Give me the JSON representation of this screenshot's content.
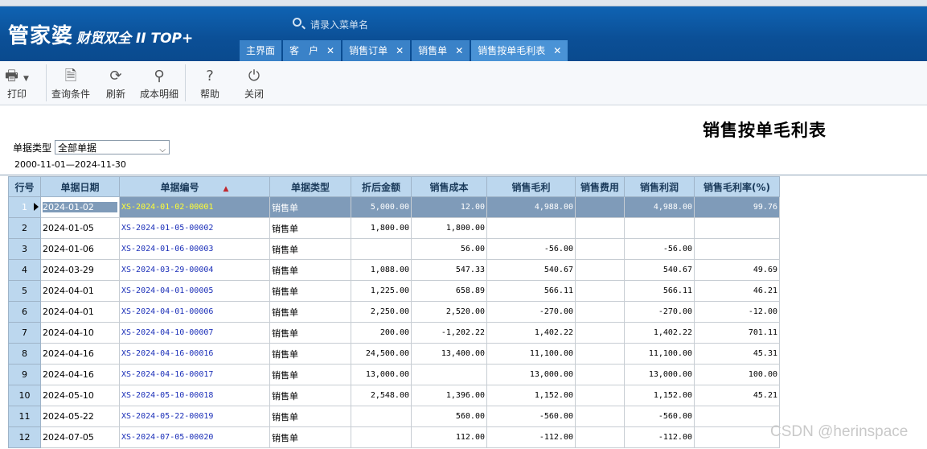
{
  "app": {
    "logo_main": "管家婆",
    "logo_sub": "财贸双全 II TOP+",
    "search_placeholder": "请录入菜单名"
  },
  "tabs": [
    {
      "label": "主界面",
      "closable": false
    },
    {
      "label": "客　户",
      "closable": true
    },
    {
      "label": "销售订单",
      "closable": true
    },
    {
      "label": "销售单",
      "closable": true
    },
    {
      "label": "销售按单毛利表",
      "closable": true,
      "active": true
    }
  ],
  "toolbar": {
    "print": "打印",
    "query": "查询条件",
    "refresh": "刷新",
    "cost_detail": "成本明细",
    "help": "帮助",
    "close": "关闭"
  },
  "report": {
    "title": "销售按单毛利表",
    "filter_label": "单据类型",
    "filter_value": "全部单据",
    "date_range": "2000-11-01—2024-11-30"
  },
  "columns": [
    "行号",
    "单据日期",
    "单据编号",
    "单据类型",
    "折后金额",
    "销售成本",
    "销售毛利",
    "销售费用",
    "销售利润",
    "销售毛利率(%)"
  ],
  "rows": [
    [
      "1",
      "2024-01-02",
      "XS-2024-01-02-00001",
      "销售单",
      "5,000.00",
      "12.00",
      "4,988.00",
      "",
      "4,988.00",
      "99.76"
    ],
    [
      "2",
      "2024-01-05",
      "XS-2024-01-05-00002",
      "销售单",
      "1,800.00",
      "1,800.00",
      "",
      "",
      "",
      ""
    ],
    [
      "3",
      "2024-01-06",
      "XS-2024-01-06-00003",
      "销售单",
      "",
      "56.00",
      "-56.00",
      "",
      "-56.00",
      ""
    ],
    [
      "4",
      "2024-03-29",
      "XS-2024-03-29-00004",
      "销售单",
      "1,088.00",
      "547.33",
      "540.67",
      "",
      "540.67",
      "49.69"
    ],
    [
      "5",
      "2024-04-01",
      "XS-2024-04-01-00005",
      "销售单",
      "1,225.00",
      "658.89",
      "566.11",
      "",
      "566.11",
      "46.21"
    ],
    [
      "6",
      "2024-04-01",
      "XS-2024-04-01-00006",
      "销售单",
      "2,250.00",
      "2,520.00",
      "-270.00",
      "",
      "-270.00",
      "-12.00"
    ],
    [
      "7",
      "2024-04-10",
      "XS-2024-04-10-00007",
      "销售单",
      "200.00",
      "-1,202.22",
      "1,402.22",
      "",
      "1,402.22",
      "701.11"
    ],
    [
      "8",
      "2024-04-16",
      "XS-2024-04-16-00016",
      "销售单",
      "24,500.00",
      "13,400.00",
      "11,100.00",
      "",
      "11,100.00",
      "45.31"
    ],
    [
      "9",
      "2024-04-16",
      "XS-2024-04-16-00017",
      "销售单",
      "13,000.00",
      "",
      "13,000.00",
      "",
      "13,000.00",
      "100.00"
    ],
    [
      "10",
      "2024-05-10",
      "XS-2024-05-10-00018",
      "销售单",
      "2,548.00",
      "1,396.00",
      "1,152.00",
      "",
      "1,152.00",
      "45.21"
    ],
    [
      "11",
      "2024-05-22",
      "XS-2024-05-22-00019",
      "销售单",
      "",
      "560.00",
      "-560.00",
      "",
      "-560.00",
      ""
    ],
    [
      "12",
      "2024-07-05",
      "XS-2024-07-05-00020",
      "销售单",
      "",
      "112.00",
      "-112.00",
      "",
      "-112.00",
      ""
    ]
  ],
  "watermark": "CSDN @herinspace"
}
